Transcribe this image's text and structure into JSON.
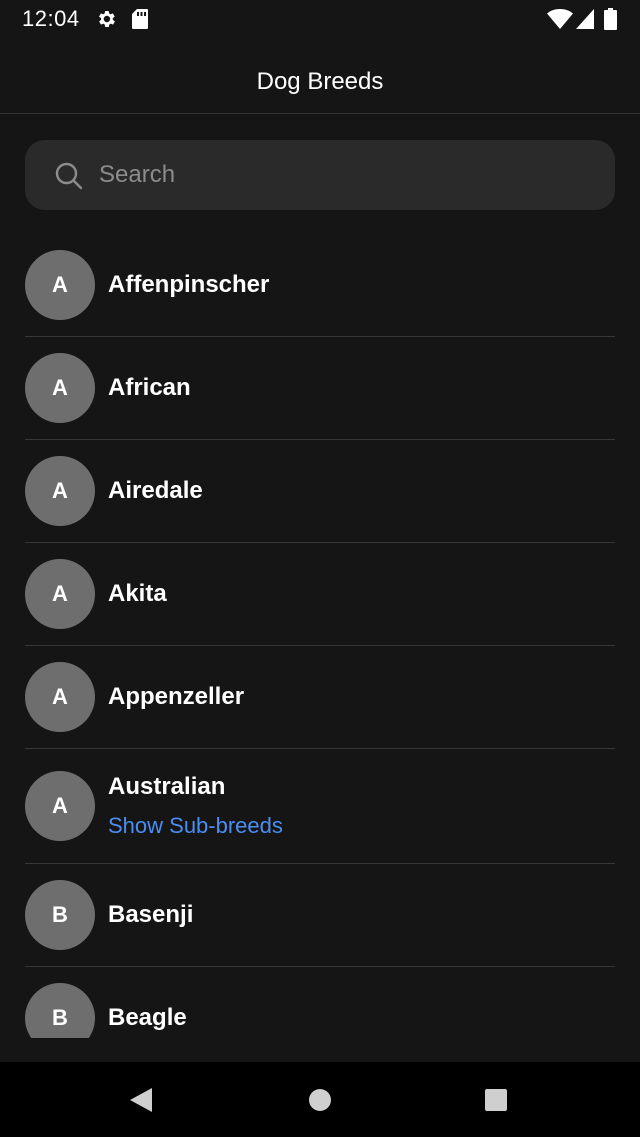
{
  "status_bar": {
    "time": "12:04",
    "icons": [
      "gear-icon",
      "sd-card-icon",
      "wifi-icon",
      "signal-icon",
      "battery-icon"
    ]
  },
  "app_bar": {
    "title": "Dog Breeds"
  },
  "search": {
    "placeholder": "Search",
    "value": ""
  },
  "breeds": [
    {
      "initial": "A",
      "name": "Affenpinscher"
    },
    {
      "initial": "A",
      "name": "African"
    },
    {
      "initial": "A",
      "name": "Airedale"
    },
    {
      "initial": "A",
      "name": "Akita"
    },
    {
      "initial": "A",
      "name": "Appenzeller"
    },
    {
      "initial": "A",
      "name": "Australian",
      "link": "Show Sub-breeds"
    },
    {
      "initial": "B",
      "name": "Basenji"
    },
    {
      "initial": "B",
      "name": "Beagle"
    }
  ],
  "nav_bar": {
    "buttons": [
      "back-icon",
      "home-icon",
      "recents-icon"
    ]
  },
  "colors": {
    "background": "#151515",
    "search_bg": "#2a2a2a",
    "avatar_bg": "#6e6e6e",
    "link": "#4a8ef2",
    "divider": "#363636"
  }
}
